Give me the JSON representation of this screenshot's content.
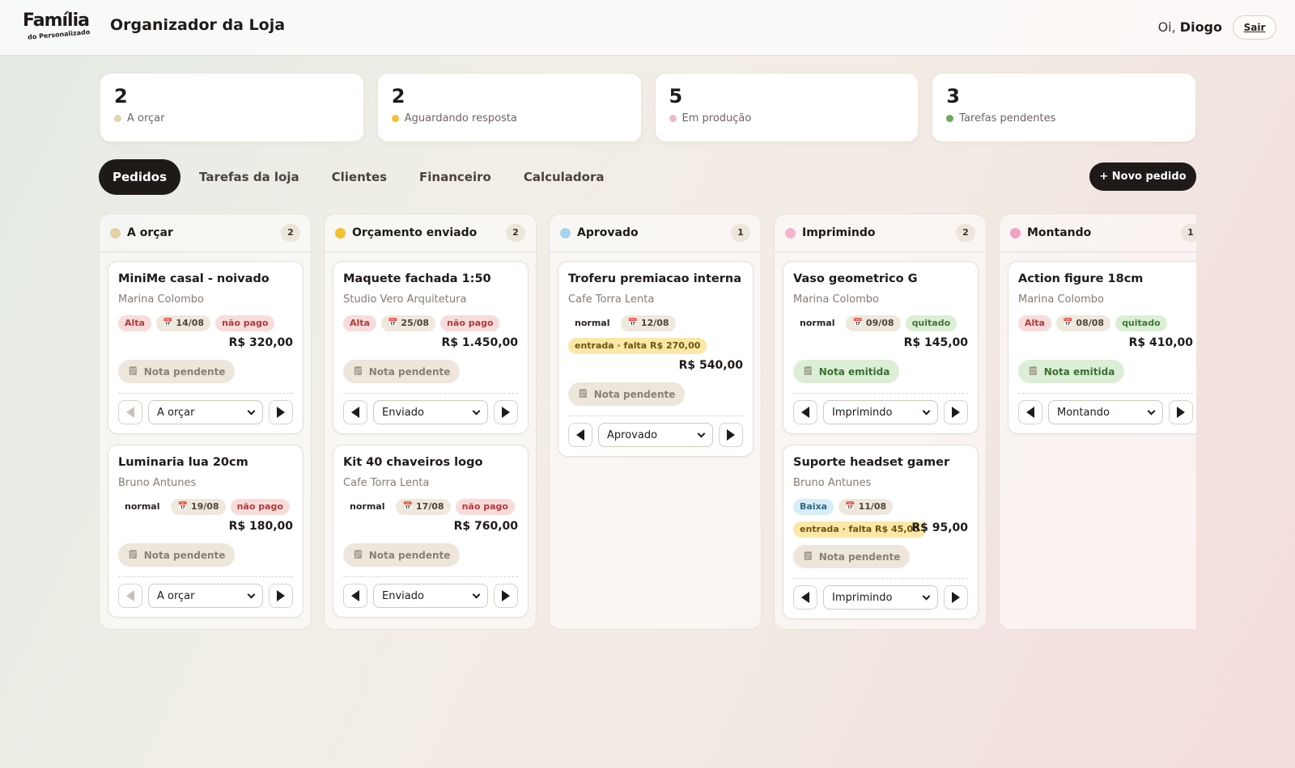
{
  "header": {
    "logo_line1": "Família",
    "logo_line2": "do Personalizado",
    "title": "Organizador da Loja",
    "greeting_prefix": "Oi,",
    "user_name": "Diogo",
    "logout": "Sair"
  },
  "colors": {
    "a_orcar": "#e5d3a8",
    "aguardando": "#f2c12e",
    "em_producao": "#f1b9cd",
    "tarefas": "#6aaa58",
    "aprovado": "#a9d4ee",
    "imprimindo": "#f5b3cf",
    "montando": "#f0a2c0"
  },
  "stats": [
    {
      "value": "2",
      "label": "A orçar"
    },
    {
      "value": "2",
      "label": "Aguardando resposta"
    },
    {
      "value": "5",
      "label": "Em produção"
    },
    {
      "value": "3",
      "label": "Tarefas pendentes"
    }
  ],
  "tabs": [
    "Pedidos",
    "Tarefas da loja",
    "Clientes",
    "Financeiro",
    "Calculadora"
  ],
  "new_order": "+ Novo pedido",
  "columns": [
    {
      "title": "A orçar",
      "count": "2",
      "cards": [
        {
          "title": "MiniMe casal - noivado",
          "client": "Marina Colombo",
          "priority": "Alta",
          "date": "14/08",
          "payment": "não pago",
          "price": "R$ 320,00",
          "nota": "Nota pendente",
          "status": "A orçar"
        },
        {
          "title": "Luminaria lua 20cm",
          "client": "Bruno Antunes",
          "priority": "normal",
          "date": "19/08",
          "payment": "não pago",
          "price": "R$ 180,00",
          "nota": "Nota pendente",
          "status": "A orçar"
        }
      ]
    },
    {
      "title": "Orçamento enviado",
      "count": "2",
      "cards": [
        {
          "title": "Maquete fachada 1:50",
          "client": "Studio Vero Arquitetura",
          "priority": "Alta",
          "date": "25/08",
          "payment": "não pago",
          "price": "R$ 1.450,00",
          "nota": "Nota pendente",
          "status": "Enviado"
        },
        {
          "title": "Kit 40 chaveiros logo",
          "client": "Cafe Torra Lenta",
          "priority": "normal",
          "date": "17/08",
          "payment": "não pago",
          "price": "R$ 760,00",
          "nota": "Nota pendente",
          "status": "Enviado"
        }
      ]
    },
    {
      "title": "Aprovado",
      "count": "1",
      "cards": [
        {
          "title": "Troferu premiacao interna",
          "client": "Cafe Torra Lenta",
          "priority": "normal",
          "date": "12/08",
          "payment": "entrada · falta R$ 270,00",
          "price": "R$ 540,00",
          "nota": "Nota pendente",
          "status": "Aprovado"
        }
      ]
    },
    {
      "title": "Imprimindo",
      "count": "2",
      "cards": [
        {
          "title": "Vaso geometrico G",
          "client": "Marina Colombo",
          "priority": "normal",
          "date": "09/08",
          "payment": "quitado",
          "price": "R$ 145,00",
          "nota": "Nota emitida",
          "status": "Imprimindo"
        },
        {
          "title": "Suporte headset gamer",
          "client": "Bruno Antunes",
          "priority": "Baixa",
          "date": "11/08",
          "payment": "entrada · falta R$ 45,00",
          "price": "R$ 95,00",
          "nota": "Nota pendente",
          "status": "Imprimindo"
        }
      ]
    },
    {
      "title": "Montando",
      "count": "1",
      "cards": [
        {
          "title": "Action figure 18cm",
          "client": "Marina Colombo",
          "priority": "Alta",
          "date": "08/08",
          "payment": "quitado",
          "price": "R$ 410,00",
          "nota": "Nota emitida",
          "status": "Montando"
        }
      ]
    }
  ]
}
